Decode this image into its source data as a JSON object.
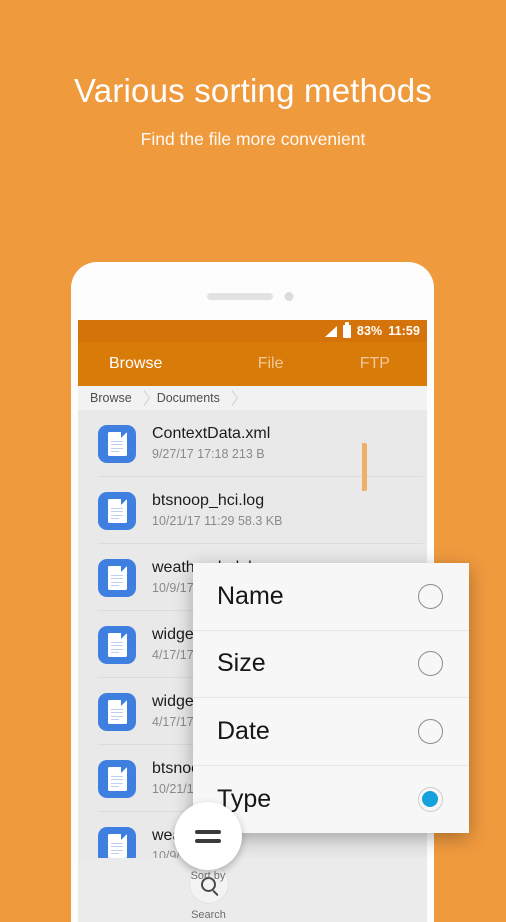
{
  "promo": {
    "title": "Various sorting methods",
    "subtitle": "Find the file more convenient"
  },
  "colors": {
    "background_orange": "#F09A3E",
    "toolbar_orange": "#D97B09",
    "statusbar_orange": "#D4730A",
    "accent_blue": "#15A2DC",
    "file_icon_blue": "#3F7FE0"
  },
  "statusbar": {
    "signal_icon": "signal-icon",
    "battery_icon": "battery-icon",
    "battery_percent": "83%",
    "time": "11:59"
  },
  "tabs": [
    {
      "label": "Browse",
      "active": true
    },
    {
      "label": "File",
      "active": false
    },
    {
      "label": "FTP",
      "active": false
    }
  ],
  "breadcrumb": [
    {
      "label": "Browse"
    },
    {
      "label": "Documents"
    }
  ],
  "files": [
    {
      "name": "ContextData.xml",
      "meta": "9/27/17 17:18  213 B",
      "icon": "document-icon"
    },
    {
      "name": "btsnoop_hci.log",
      "meta": "10/21/17 11:29  58.3 KB",
      "icon": "document-icon"
    },
    {
      "name": "weather_bak.log",
      "meta": "10/9/17 1",
      "icon": "document-icon"
    },
    {
      "name": "widget_",
      "meta": "4/17/17 1",
      "icon": "document-icon"
    },
    {
      "name": "widget_",
      "meta": "4/17/17 1",
      "icon": "document-icon"
    },
    {
      "name": "btsnoop",
      "meta": "10/21/17",
      "icon": "document-icon"
    },
    {
      "name": "weather",
      "meta": "10/9/17 1",
      "icon": "document-icon"
    }
  ],
  "bottom_nav": {
    "search": {
      "label": "Search",
      "icon": "search-icon"
    },
    "sort_by": {
      "label": "Sort by",
      "icon": "hamburger-icon"
    }
  },
  "sort_dialog": {
    "options": [
      {
        "label": "Name",
        "selected": false
      },
      {
        "label": "Size",
        "selected": false
      },
      {
        "label": "Date",
        "selected": false
      },
      {
        "label": "Type",
        "selected": true
      }
    ]
  }
}
